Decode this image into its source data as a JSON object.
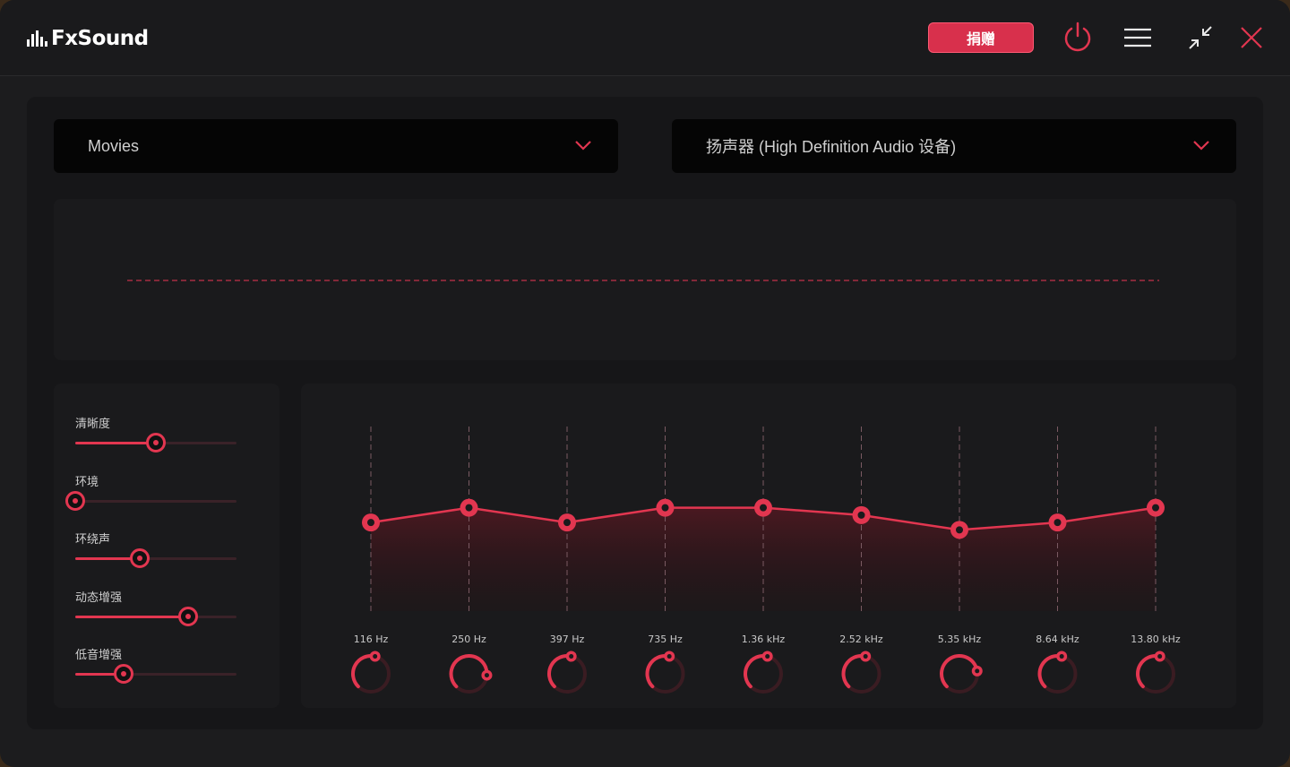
{
  "app": {
    "name": "FxSound"
  },
  "toolbar": {
    "donate_label": "捐赠"
  },
  "colors": {
    "accent": "#e23650",
    "background": "#1c1c1e",
    "panel": "#1a1a1c"
  },
  "preset_select": {
    "value": "Movies"
  },
  "output_select": {
    "value": "扬声器 (High Definition Audio 设备)"
  },
  "effects": [
    {
      "label": "清晰度",
      "value": 0.5
    },
    {
      "label": "环境",
      "value": 0.0
    },
    {
      "label": "环绕声",
      "value": 0.4
    },
    {
      "label": "动态增强",
      "value": 0.7
    },
    {
      "label": "低音增强",
      "value": 0.3
    }
  ],
  "eq_bands": [
    {
      "label": "116 Hz",
      "level": 0.48,
      "knob": 0.05
    },
    {
      "label": "250 Hz",
      "level": 0.56,
      "knob": 0.35
    },
    {
      "label": "397 Hz",
      "level": 0.48,
      "knob": 0.05
    },
    {
      "label": "735 Hz",
      "level": 0.56,
      "knob": 0.05
    },
    {
      "label": "1.36 kHz",
      "level": 0.56,
      "knob": 0.05
    },
    {
      "label": "2.52 kHz",
      "level": 0.52,
      "knob": 0.05
    },
    {
      "label": "5.35 kHz",
      "level": 0.44,
      "knob": 0.3
    },
    {
      "label": "8.64 kHz",
      "level": 0.48,
      "knob": 0.05
    },
    {
      "label": "13.80 kHz",
      "level": 0.56,
      "knob": 0.05
    }
  ],
  "icons": {
    "power": "power-icon",
    "menu": "hamburger-menu-icon",
    "minimize": "minimize-icon",
    "close": "close-icon",
    "dropdown": "chevron-down-icon"
  }
}
